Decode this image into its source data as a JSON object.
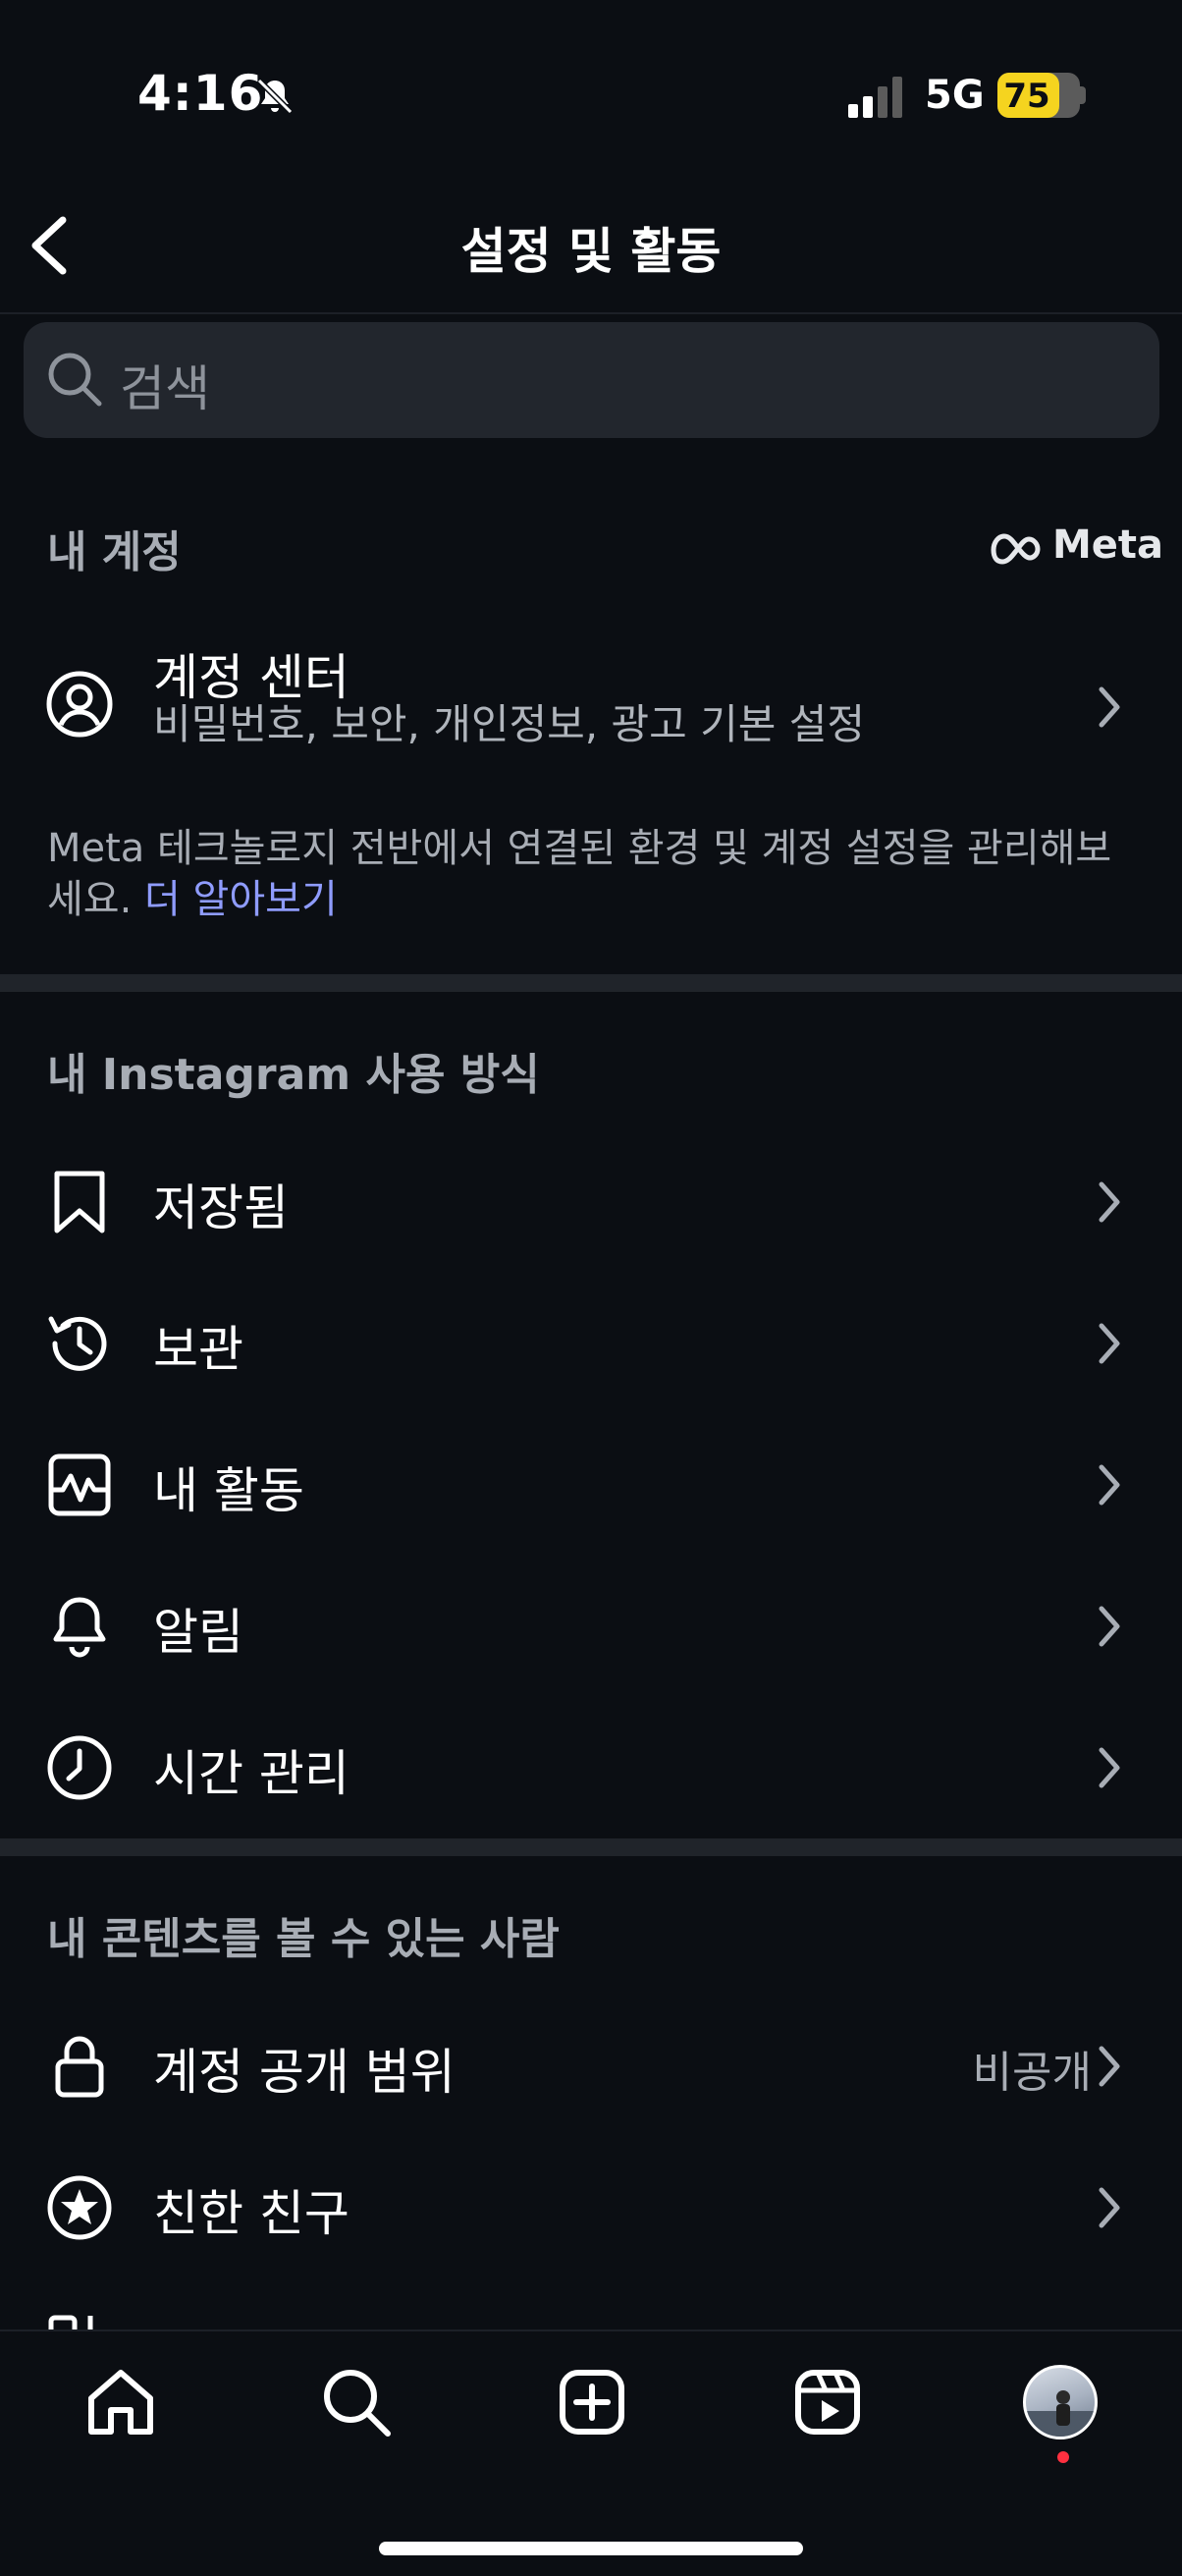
{
  "status_bar": {
    "time": "4:16",
    "network": "5G",
    "battery": "75",
    "battery_level": 0.75
  },
  "header": {
    "title": "설정 및 활동"
  },
  "search": {
    "placeholder": "검색"
  },
  "account_section": {
    "title": "내 계정",
    "brand": "Meta",
    "account_center": {
      "label": "계정 센터",
      "subtitle": "비밀번호, 보안, 개인정보, 광고 기본 설정"
    },
    "description": "Meta 테크놀로지 전반에서 연결된 환경 및 계정 설정을 관리해보세요.",
    "learn_more": "더 알아보기"
  },
  "usage_section": {
    "title": "내 Instagram 사용 방식",
    "items": [
      {
        "label": "저장됨",
        "icon": "bookmark-icon"
      },
      {
        "label": "보관",
        "icon": "archive-history-icon"
      },
      {
        "label": "내 활동",
        "icon": "activity-icon"
      },
      {
        "label": "알림",
        "icon": "bell-icon"
      },
      {
        "label": "시간 관리",
        "icon": "clock-icon"
      }
    ]
  },
  "visibility_section": {
    "title": "내 콘텐츠를 볼 수 있는 사람",
    "items": [
      {
        "label": "계정 공개 범위",
        "value": "비공개",
        "icon": "lock-icon"
      },
      {
        "label": "친한 친구",
        "icon": "star-circle-icon"
      }
    ]
  },
  "tab_bar": {
    "tabs": [
      "home-icon",
      "search-icon",
      "create-icon",
      "reels-icon",
      "profile-avatar"
    ]
  },
  "colors": {
    "background": "#0b0e13",
    "link": "#8f9cff",
    "battery": "#f5d41f",
    "notification": "#ff3040"
  }
}
